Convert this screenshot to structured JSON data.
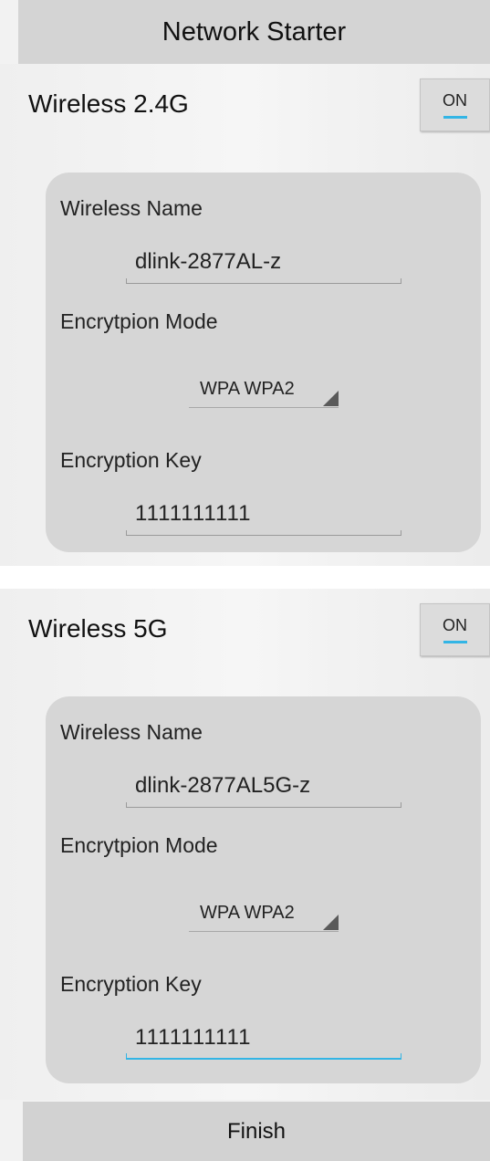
{
  "header": {
    "title": "Network Starter"
  },
  "wireless_24": {
    "title": "Wireless 2.4G",
    "toggle_label": "ON",
    "name_label": "Wireless Name",
    "name_value": "dlink-2877AL-z",
    "mode_label": "Encrytpion Mode",
    "mode_value": "WPA WPA2",
    "key_label": "Encryption Key",
    "key_value": "1111111111"
  },
  "wireless_5": {
    "title": "Wireless 5G",
    "toggle_label": "ON",
    "name_label": "Wireless Name",
    "name_value": "dlink-2877AL5G-z",
    "mode_label": "Encrytpion Mode",
    "mode_value": "WPA WPA2",
    "key_label": "Encryption Key",
    "key_value": "1111111111"
  },
  "footer": {
    "finish_label": "Finish"
  },
  "colors": {
    "accent": "#33b5e5",
    "card": "#d6d6d6",
    "header": "#d4d4d4"
  }
}
